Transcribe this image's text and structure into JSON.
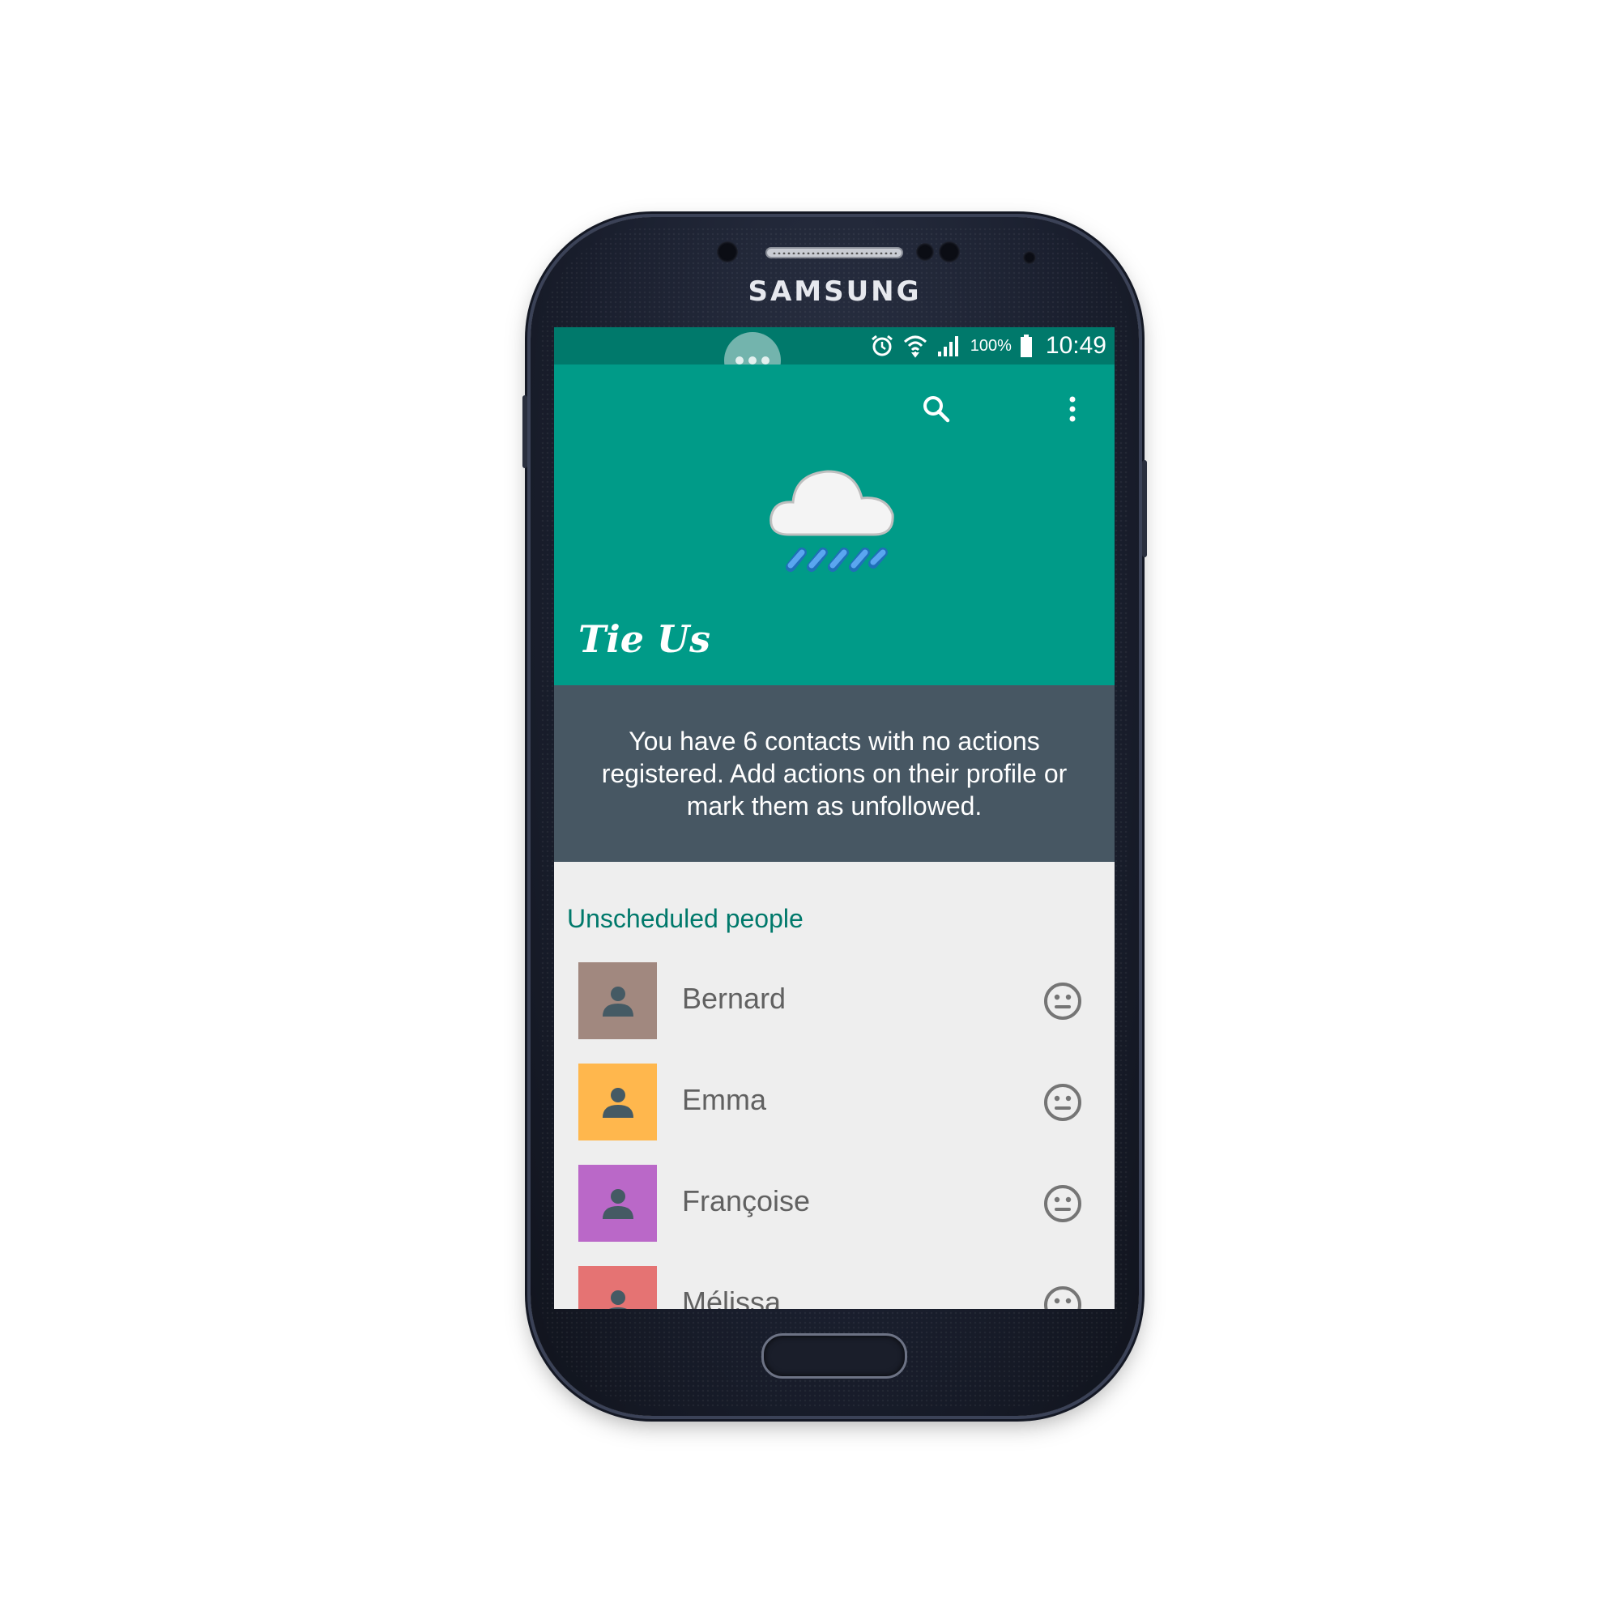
{
  "device": {
    "brand": "SAMSUNG"
  },
  "status_bar": {
    "battery": "100%",
    "time": "10:49"
  },
  "app": {
    "title": "Tie Us",
    "accent": "#009b88",
    "dark_accent": "#00796b"
  },
  "header": {
    "search_icon": "search-icon",
    "menu_icon": "more-vert-icon",
    "illustration": "rain-cloud-icon"
  },
  "banner": {
    "text": "You have 6 contacts with no actions registered. Add actions on their profile or mark them as unfollowed."
  },
  "section": {
    "title": "Unscheduled people"
  },
  "contacts": [
    {
      "name": "Bernard",
      "color": "#a1887f",
      "mood_icon": "neutral-face-icon"
    },
    {
      "name": "Emma",
      "color": "#ffb74d",
      "mood_icon": "neutral-face-icon"
    },
    {
      "name": "Françoise",
      "color": "#ba68c8",
      "mood_icon": "neutral-face-icon"
    },
    {
      "name": "Mélissa",
      "color": "#e57373",
      "mood_icon": "neutral-face-icon"
    }
  ]
}
